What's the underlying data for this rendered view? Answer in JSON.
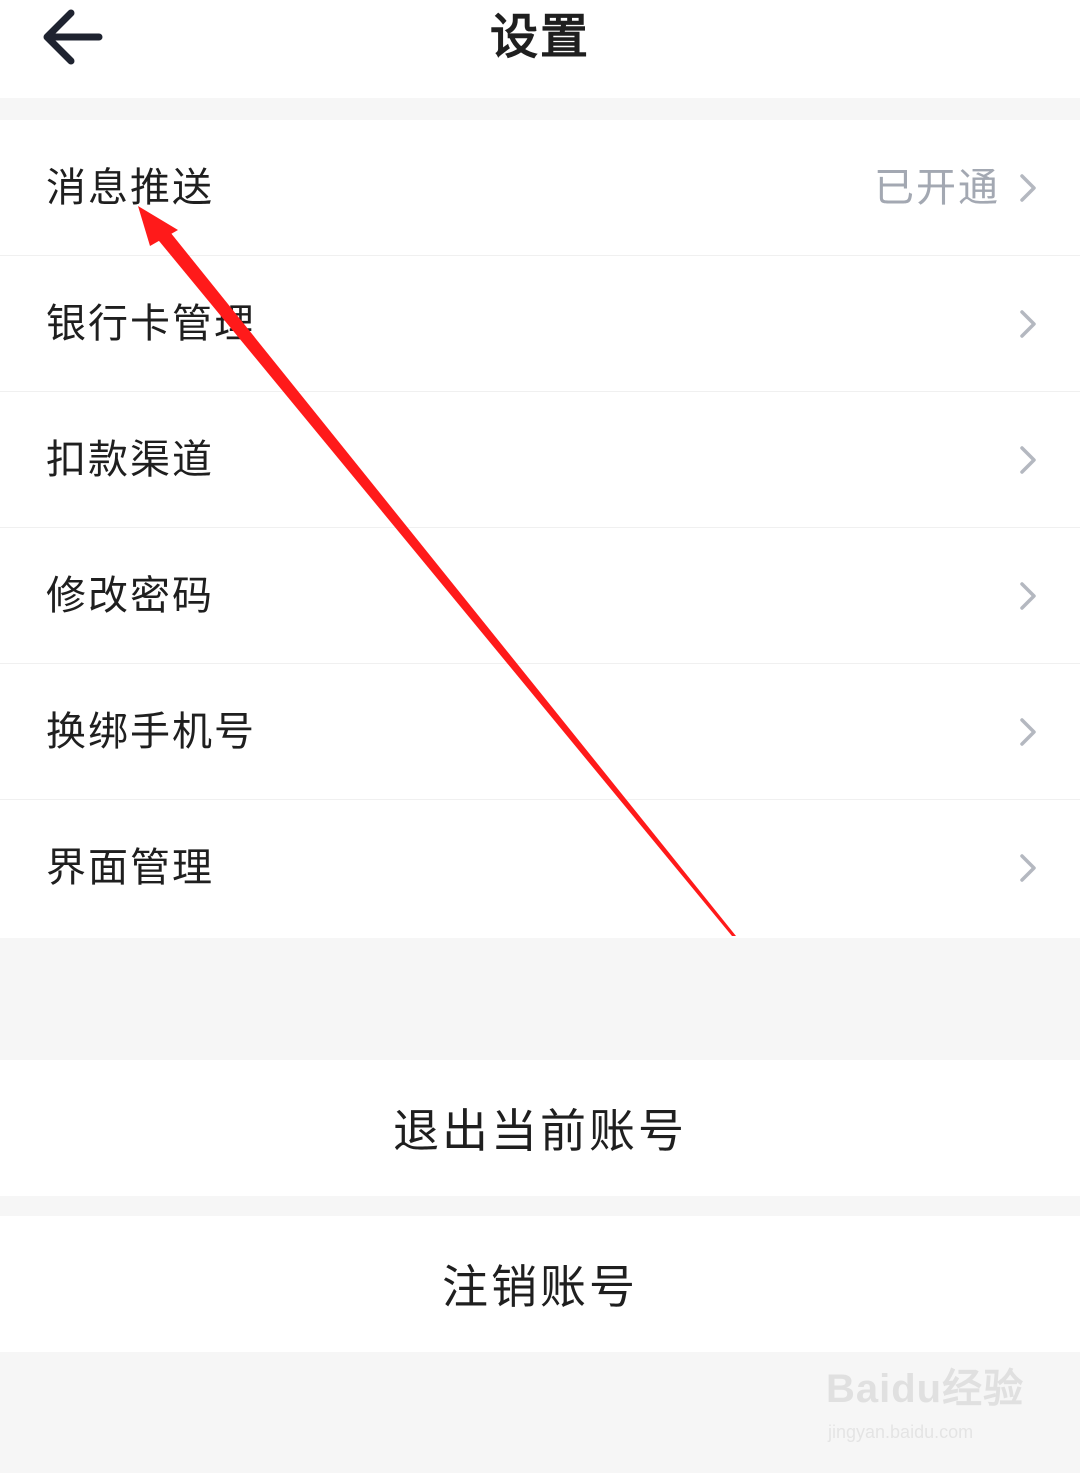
{
  "header": {
    "title": "设置",
    "back_icon": "arrow-left-icon"
  },
  "settings": {
    "items": [
      {
        "label": "消息推送",
        "status": "已开通"
      },
      {
        "label": "银行卡管理"
      },
      {
        "label": "扣款渠道"
      },
      {
        "label": "修改密码"
      },
      {
        "label": "换绑手机号"
      },
      {
        "label": "界面管理"
      }
    ],
    "chevron_icon": "chevron-right-icon"
  },
  "actions": {
    "logout_label": "退出当前账号",
    "deregister_label": "注销账号"
  },
  "annotation": {
    "color": "#ff1a1a",
    "icon": "red-arrow-annotation"
  },
  "watermark": {
    "brand": "Baidu经验",
    "url": "jingyan.baidu.com"
  },
  "colors": {
    "background": "#f6f6f6",
    "surface": "#ffffff",
    "text": "#1f1f1f",
    "muted": "#a3a8b2"
  }
}
